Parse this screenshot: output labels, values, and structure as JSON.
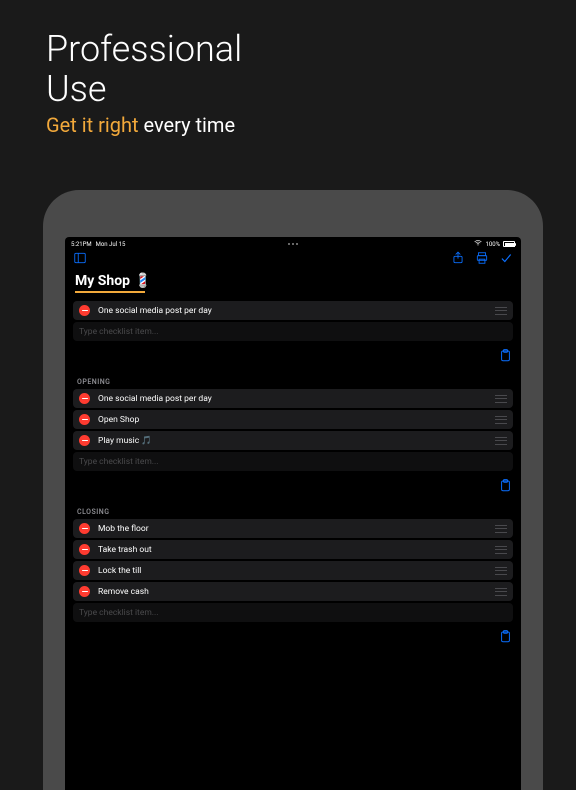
{
  "promo": {
    "title_line1": "Professional",
    "title_line2": "Use",
    "sub_accent": "Get it right",
    "sub_rest": " every time"
  },
  "statusbar": {
    "time": "5:21PM",
    "date": "Mon Jul 15",
    "wifi": "wifi",
    "battery_pct": "100%"
  },
  "list": {
    "title": "My Shop",
    "emoji": "💈"
  },
  "top_section": {
    "items": [
      "One social media post per day"
    ],
    "placeholder": "Type checklist item..."
  },
  "sections": [
    {
      "name": "OPENING",
      "items": [
        {
          "text": "One social media post per day"
        },
        {
          "text": "Open Shop"
        },
        {
          "text": "Play music 🎵"
        }
      ],
      "placeholder": "Type checklist item..."
    },
    {
      "name": "CLOSING",
      "items": [
        {
          "text": "Mob the floor"
        },
        {
          "text": "Take trash out"
        },
        {
          "text": "Lock the till"
        },
        {
          "text": "Remove cash"
        }
      ],
      "placeholder": "Type checklist item..."
    }
  ]
}
